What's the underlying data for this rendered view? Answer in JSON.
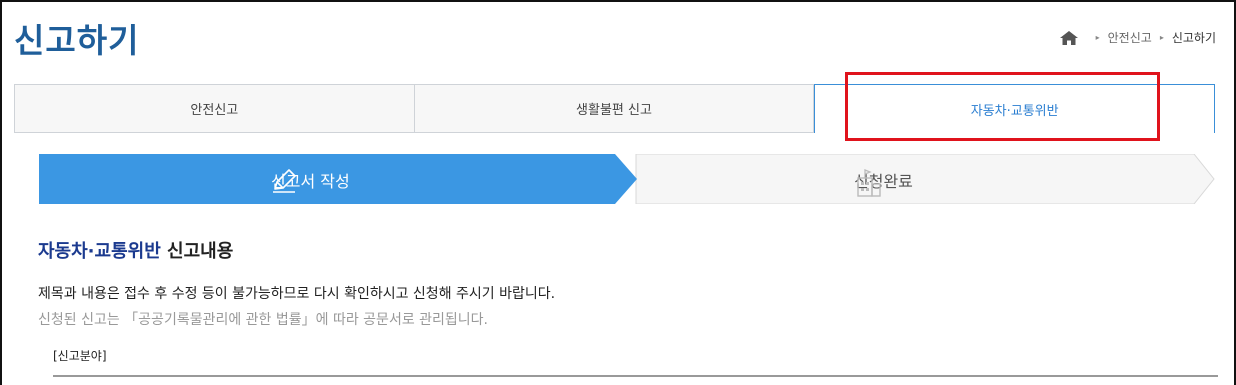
{
  "page": {
    "title": "신고하기"
  },
  "breadcrumb": {
    "items": [
      "안전신고",
      "신고하기"
    ]
  },
  "tabs": [
    {
      "label": "안전신고",
      "active": false
    },
    {
      "label": "생활불편 신고",
      "active": false
    },
    {
      "label": "자동차·교통위반",
      "active": true
    }
  ],
  "steps": [
    {
      "label": "신고서 작성",
      "icon": "pencil-icon",
      "active": true
    },
    {
      "label": "신청완료",
      "icon": "building-icon",
      "active": false
    }
  ],
  "section": {
    "title_highlight": "자동차·교통위반",
    "title_rest": " 신고내용",
    "notice1": "제목과 내용은 접수 후 수정 등이 불가능하므로 다시 확인하시고 신청해 주시기 바랍니다.",
    "notice2": "신청된 신고는 「공공기록물관리에 관한 법률」에 따라 공문서로 관리됩니다.",
    "field_label": "[신고분야]"
  },
  "colors": {
    "accent": "#3b97e3",
    "title": "#1f5e9a",
    "highlight_box": "#e0131c"
  }
}
